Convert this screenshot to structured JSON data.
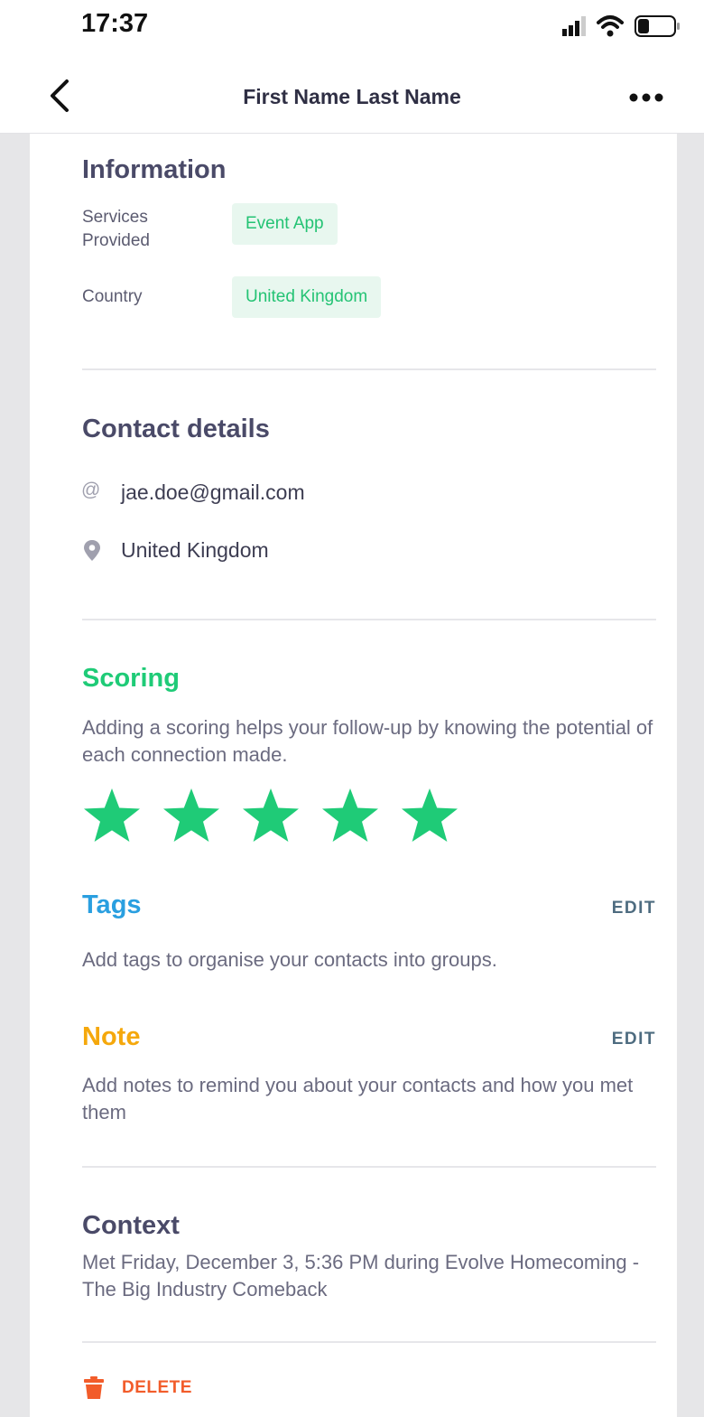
{
  "status_bar": {
    "time": "17:37",
    "icons": [
      "signal-icon",
      "wifi-icon",
      "battery-icon"
    ]
  },
  "nav": {
    "title": "First Name Last Name",
    "back_icon": "chevron-left-icon",
    "more_icon": "more-dots-icon"
  },
  "information": {
    "heading": "Information",
    "rows": [
      {
        "label_lines": [
          "Services",
          "Provided"
        ],
        "value": "Event App"
      },
      {
        "label_lines": [
          "Country"
        ],
        "value": "United Kingdom"
      }
    ]
  },
  "contact": {
    "heading": "Contact details",
    "email": "jae.doe@gmail.com",
    "email_icon": "at-sign-icon",
    "location": "United Kingdom",
    "location_icon": "map-pin-icon"
  },
  "scoring": {
    "heading": "Scoring",
    "description": "Adding a scoring helps your follow-up by knowing the potential of each connection made.",
    "rating": 5,
    "max_rating": 5
  },
  "tags": {
    "heading": "Tags",
    "edit_label": "EDIT",
    "description": "Add tags to organise your contacts into groups."
  },
  "note": {
    "heading": "Note",
    "edit_label": "EDIT",
    "description": "Add notes to remind you about your contacts and how you met them"
  },
  "context": {
    "heading": "Context",
    "description": "Met Friday, December 3, 5:36 PM during Evolve Homecoming - The Big Industry Comeback"
  },
  "delete": {
    "label": "DELETE",
    "icon": "trash-icon"
  },
  "colors": {
    "green": "#1fcb77",
    "tags_blue": "#2a9fe0",
    "note_orange": "#f5a80c",
    "delete_red": "#f25c2a",
    "heading_dark": "#4a4a68"
  }
}
